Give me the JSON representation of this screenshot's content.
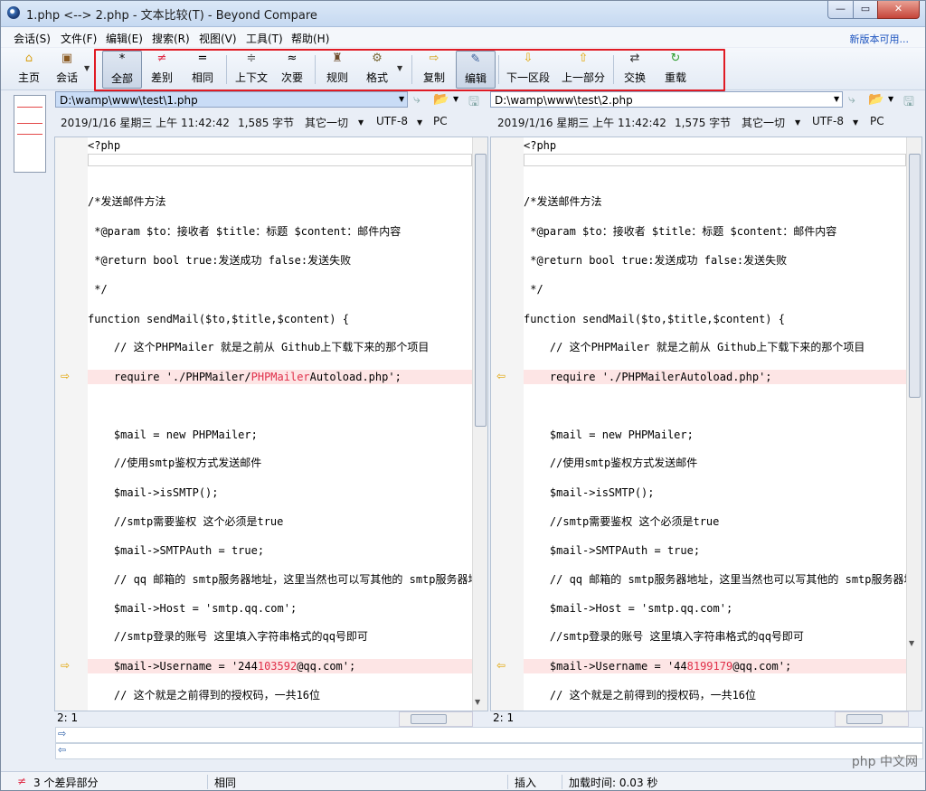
{
  "window": {
    "title": "1.php <--> 2.php - 文本比较(T) - Beyond Compare",
    "min": "—",
    "max": "▭",
    "close": "✕"
  },
  "menu": [
    "会话(S)",
    "文件(F)",
    "编辑(E)",
    "搜索(R)",
    "视图(V)",
    "工具(T)",
    "帮助(H)"
  ],
  "new_version": "新版本可用...",
  "toolbar": {
    "home": "主页",
    "session": "会话",
    "all": "全部",
    "diff": "差别",
    "same": "相同",
    "context": "上下文",
    "minor": "次要",
    "rules": "规则",
    "format": "格式",
    "copy": "复制",
    "edit": "编辑",
    "next": "下一区段",
    "prev": "上一部分",
    "swap": "交换",
    "reload": "重载"
  },
  "left": {
    "path": "D:\\wamp\\www\\test\\1.php",
    "date": "2019/1/16 星期三 上午 11:42:42",
    "size": "1,585 字节",
    "other": "其它一切",
    "encoding": "UTF-8",
    "lineend": "PC",
    "position": "2: 1",
    "lines": [
      "<?php",
      "",
      "",
      "/*发送邮件方法",
      " *@param $to：接收者 $title：标题 $content：邮件内容",
      " *@return bool true:发送成功 false:发送失败",
      " */",
      "function sendMail($to,$title,$content) {",
      "    // 这个PHPMailer 就是之前从 Github上下载下来的那个项目",
      "",
      "",
      "    $mail = new PHPMailer;",
      "    //使用smtp鉴权方式发送邮件",
      "    $mail->isSMTP();",
      "    //smtp需要鉴权 这个必须是true",
      "    $mail->SMTPAuth = true;",
      "    // qq 邮箱的 smtp服务器地址，这里当然也可以写其他的 smtp服务器地址",
      "    $mail->Host = 'smtp.qq.com';",
      "    //smtp登录的账号 这里填入字符串格式的qq号即可",
      "",
      "    // 这个就是之前得到的授权码，一共16位"
    ],
    "diff1": {
      "pre": "    require './PHPMailer/",
      "hl": "PHPMailer",
      "post": "Autoload.php';"
    },
    "diff2": {
      "pre": "    $mail->Username = '244",
      "hl": "103592",
      "post": "@qq.com';"
    }
  },
  "right": {
    "path": "D:\\wamp\\www\\test\\2.php",
    "date": "2019/1/16 星期三 上午 11:42:42",
    "size": "1,575 字节",
    "other": "其它一切",
    "encoding": "UTF-8",
    "lineend": "PC",
    "position": "2: 1",
    "lines": [
      "<?php",
      "",
      "",
      "/*发送邮件方法",
      " *@param $to：接收者 $title：标题 $content：邮件内容",
      " *@return bool true:发送成功 false:发送失败",
      " */",
      "function sendMail($to,$title,$content) {",
      "    // 这个PHPMailer 就是之前从 Github上下载下来的那个项目",
      "",
      "",
      "    $mail = new PHPMailer;",
      "    //使用smtp鉴权方式发送邮件",
      "    $mail->isSMTP();",
      "    //smtp需要鉴权 这个必须是true",
      "    $mail->SMTPAuth = true;",
      "    // qq 邮箱的 smtp服务器地址，这里当然也可以写其他的 smtp服务器地址",
      "    $mail->Host = 'smtp.qq.com';",
      "    //smtp登录的账号 这里填入字符串格式的qq号即可",
      "",
      "    // 这个就是之前得到的授权码，一共16位"
    ],
    "diff1": {
      "pre": "    require './PHPMailerAutoload.php';",
      "hl": "",
      "post": ""
    },
    "diff2": {
      "pre": "    $mail->Username = '44",
      "hl": "8199179",
      "post": "@qq.com';"
    }
  },
  "status": {
    "diff_count": "3 个差异部分",
    "same": "相同",
    "insert": "插入",
    "load_time": "加载时间: 0.03 秒"
  },
  "watermark": "php 中文网",
  "colors": {
    "diff_bg": "#fde5e5",
    "diff_text": "#e0304a",
    "highlight_box": "#e01b24"
  }
}
